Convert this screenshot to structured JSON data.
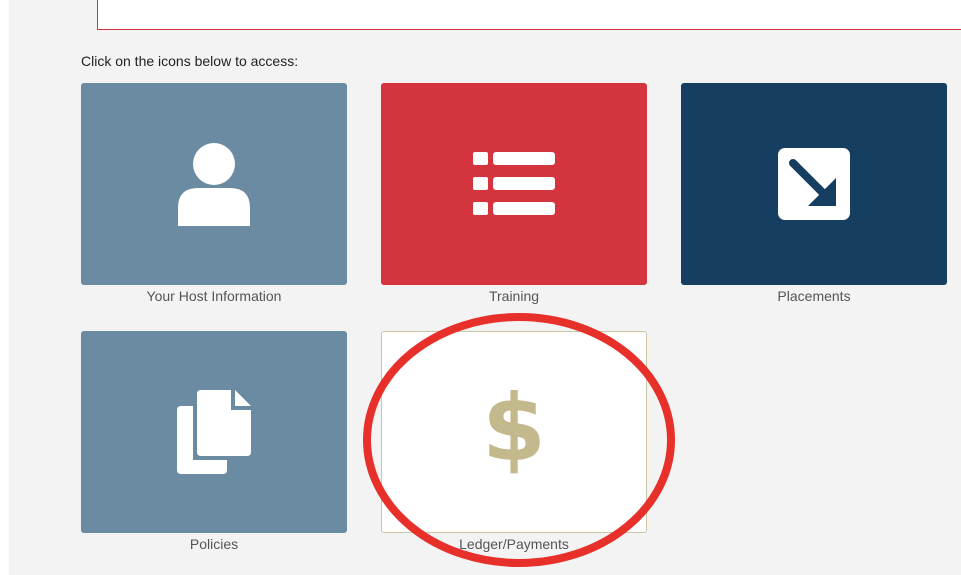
{
  "instructions": "Click on the icons below to access:",
  "tiles": [
    {
      "label": "Your Host Information",
      "icon": "user-icon",
      "color": "#6a8ba2"
    },
    {
      "label": "Training",
      "icon": "list-icon",
      "color": "#d3343d"
    },
    {
      "label": "Placements",
      "icon": "arrow-down-right-icon",
      "color": "#153e61"
    },
    {
      "label": "Policies",
      "icon": "copy-documents-icon",
      "color": "#6a8ba2"
    },
    {
      "label": "Ledger/Payments",
      "icon": "dollar-icon",
      "glyph": "$",
      "color": "#c4b98c"
    }
  ],
  "annotation": {
    "shape": "ellipse",
    "color": "#e8302a",
    "target": "Ledger/Payments"
  }
}
